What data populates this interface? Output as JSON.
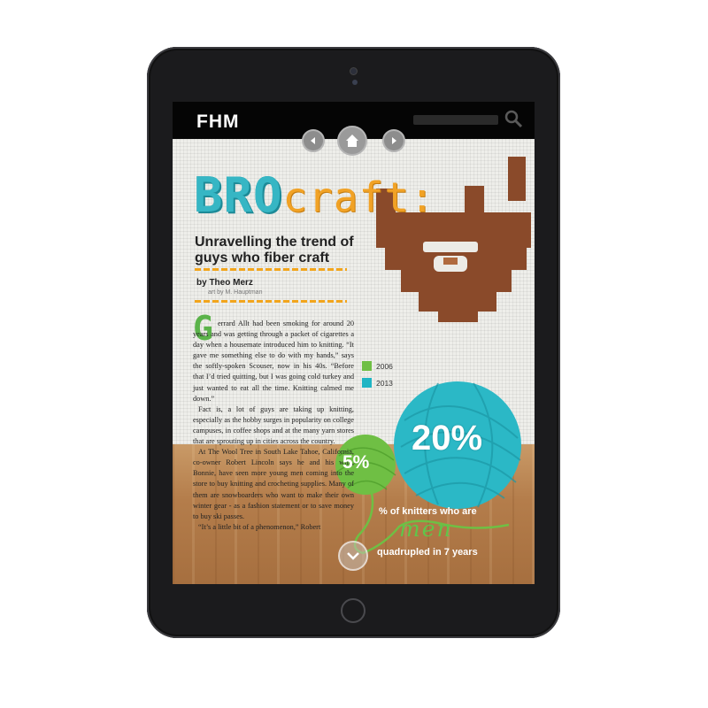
{
  "app": {
    "logo": "FHM"
  },
  "navigation": {
    "prev_icon": "chevron-left-icon",
    "home_icon": "home-icon",
    "next_icon": "chevron-right-icon",
    "search_icon": "search-icon",
    "scroll_icon": "chevron-down-icon"
  },
  "article": {
    "title_part1": "BRO",
    "title_part2": "craft:",
    "subtitle": "Unravelling the trend of guys who fiber craft",
    "byline": "by Theo Merz",
    "credit": "art by M. Hauptman",
    "dropcap": "G",
    "paragraphs": [
      "errard Allt had been smoking for around 20 years and was getting through a packet of cigarettes a day when a housemate introduced him to knitting. “It gave me something else to do with my hands,” says the softly-spoken Scouser, now in his 40s. “Before that I’d tried quitting, but I was going cold turkey and just wanted to eat all the time. Knitting calmed me down.”",
      "Fact is, a lot of guys are taking up knitting, especially as the hobby surges in popularity on college campuses, in coffee shops and at the many yarn stores that are sprouting up in cities across the country.",
      "At The Wool Tree in South Lake Tahoe, California, co-owner Robert Lincoln says he and his wife, Bonnie, have seen more young men coming into the store to buy knitting and crocheting supplies. Many of them are snowboarders who want to make their own winter gear - as a fashion statement or to save money to buy ski passes.",
      "“It’s a little bit of a phenomenon,” Robert"
    ]
  },
  "infographic": {
    "legend": [
      {
        "label": "2006",
        "color": "#6fbf44"
      },
      {
        "label": "2013",
        "color": "#1fb5c4"
      }
    ],
    "value_2006": "5%",
    "value_2013": "20%",
    "caption_line1": "% of knitters who are",
    "caption_word": "men",
    "caption_line2": "quadrupled in 7 years"
  },
  "colors": {
    "teal": "#36b6c4",
    "orange": "#f1a225",
    "green": "#6fbf44",
    "yarn_blue": "#2bb8c6",
    "beard_brown": "#8a4a2a"
  }
}
